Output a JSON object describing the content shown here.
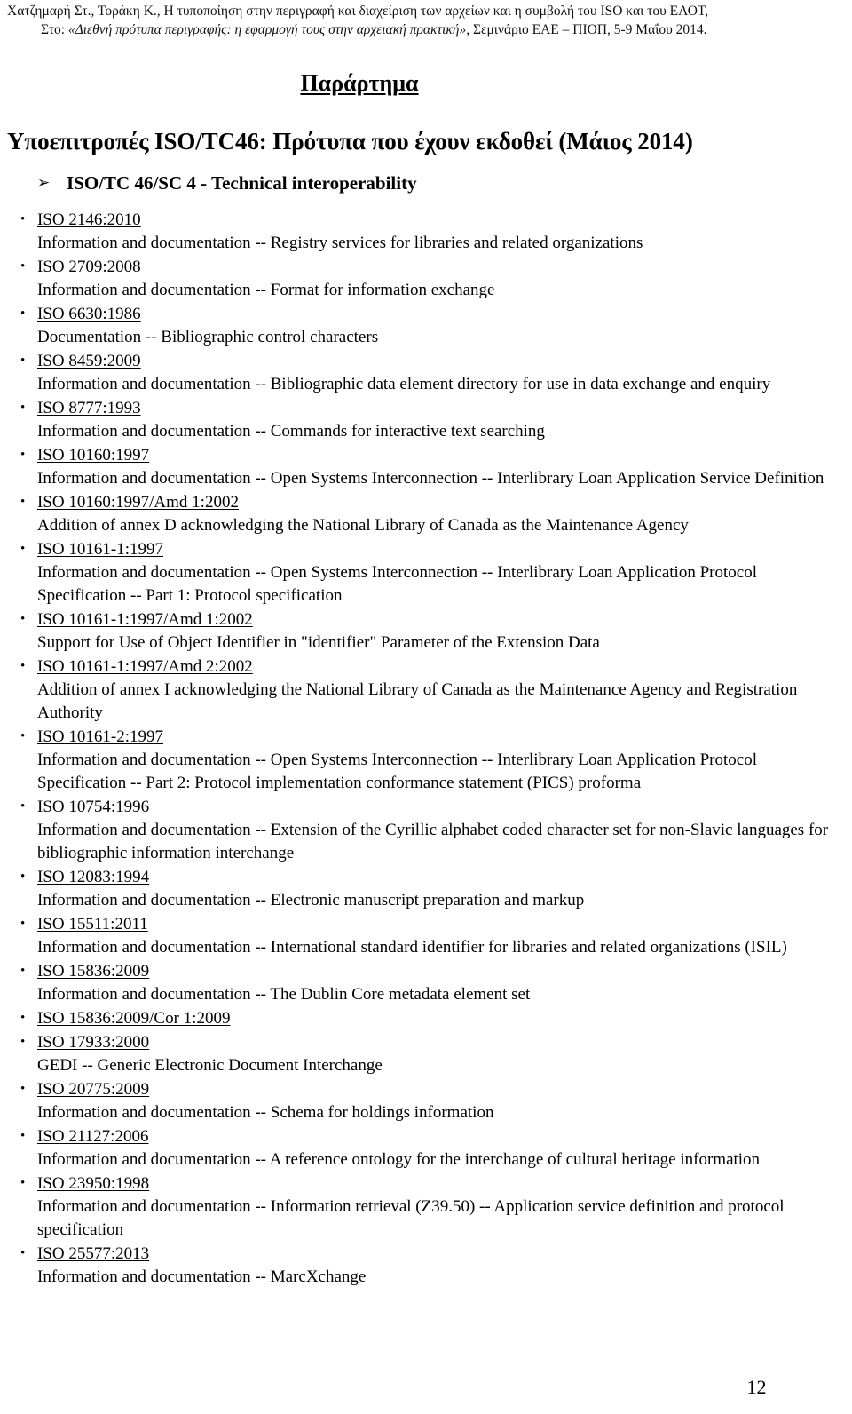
{
  "header": {
    "line1": "Χατζημαρή Στ., Τοράκη Κ., Η τυποποίηση στην περιγραφή και διαχείριση των αρχείων και η συμβολή του ISO και του ΕΛΟΤ,",
    "line2_prefix": "Στο: ",
    "line2_italic": "«Διεθνή πρότυπα περιγραφής: η εφαρμογή τους στην αρχειακή πρακτική»",
    "line2_suffix": ", Σεμινάριο ΕΑΕ – ΠΙΟΠ, 5-9 Μαΐου 2014."
  },
  "annex_heading": "Παράρτημα",
  "main_title": "Υποεπιτροπές ISO/TC46: Πρότυπα που έχουν εκδοθεί (Μάιος 2014)",
  "subcommittee": {
    "bullet_glyph": "➢",
    "label": "ISO/TC 46/SC 4  - Technical interoperability"
  },
  "list_bullet_glyph": "•",
  "standards": [
    {
      "code": "ISO 2146:2010",
      "description": "Information and documentation -- Registry services for libraries and related organizations"
    },
    {
      "code": "ISO 2709:2008",
      "description": "Information and documentation -- Format for information exchange"
    },
    {
      "code": "ISO 6630:1986",
      "description": "Documentation -- Bibliographic control characters"
    },
    {
      "code": "ISO 8459:2009",
      "description": "Information and documentation -- Bibliographic data element directory for use in data exchange and enquiry"
    },
    {
      "code": "ISO 8777:1993",
      "description": "Information and documentation -- Commands for interactive text searching"
    },
    {
      "code": "ISO 10160:1997",
      "description": "Information and documentation -- Open Systems Interconnection -- Interlibrary Loan Application Service Definition"
    },
    {
      "code": "ISO 10160:1997/Amd 1:2002",
      "description": "Addition of annex D acknowledging the National Library of Canada as the Maintenance Agency"
    },
    {
      "code": "ISO 10161-1:1997",
      "description": "Information and documentation -- Open Systems Interconnection -- Interlibrary Loan Application Protocol Specification -- Part 1: Protocol specification"
    },
    {
      "code": "ISO 10161-1:1997/Amd 1:2002",
      "description": "Support for Use of Object Identifier in \"identifier\" Parameter of the Extension Data"
    },
    {
      "code": "ISO 10161-1:1997/Amd 2:2002",
      "description": "Addition of annex I acknowledging the National Library of Canada as the Maintenance Agency and Registration Authority"
    },
    {
      "code": "ISO 10161-2:1997",
      "description": "Information and documentation -- Open Systems Interconnection -- Interlibrary Loan Application Protocol Specification -- Part 2: Protocol implementation conformance statement (PICS) proforma"
    },
    {
      "code": "ISO 10754:1996",
      "description": "Information and documentation -- Extension of the Cyrillic alphabet coded character set for non-Slavic languages for bibliographic information interchange"
    },
    {
      "code": "ISO 12083:1994",
      "description": "Information and documentation -- Electronic manuscript preparation and markup"
    },
    {
      "code": "ISO 15511:2011",
      "description": "Information and documentation -- International standard identifier for libraries and related organizations (ISIL)"
    },
    {
      "code": "ISO 15836:2009",
      "description": "Information and documentation -- The Dublin Core metadata element set"
    },
    {
      "code": "ISO 15836:2009/Cor 1:2009",
      "description": ""
    },
    {
      "code": "ISO 17933:2000",
      "description": "GEDI -- Generic Electronic Document Interchange"
    },
    {
      "code": "ISO 20775:2009",
      "description": "Information and documentation -- Schema for holdings information"
    },
    {
      "code": "ISO 21127:2006",
      "description": "Information and documentation -- A reference ontology for the interchange of cultural heritage information"
    },
    {
      "code": "ISO 23950:1998",
      "description": "Information and documentation -- Information retrieval (Z39.50) -- Application service definition and protocol specification"
    },
    {
      "code": "ISO 25577:2013",
      "description": "Information and documentation -- MarcXchange"
    }
  ],
  "page_number": "12"
}
